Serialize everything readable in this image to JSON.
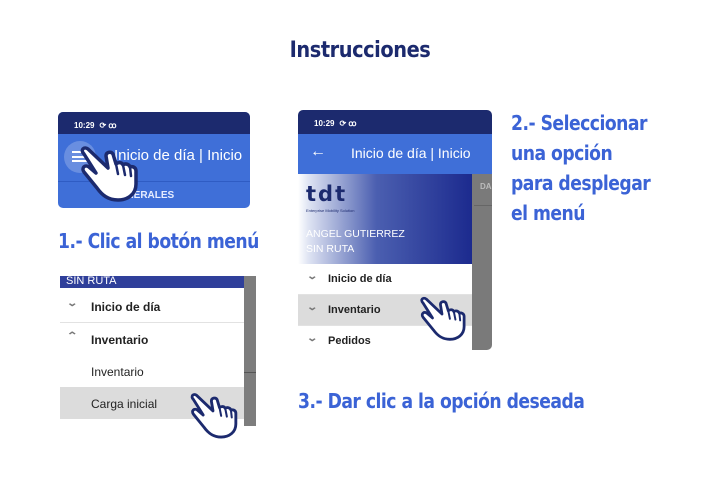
{
  "page": {
    "title": "Instrucciones"
  },
  "colors": {
    "title": "#1c2a6e",
    "step_text": "#3b63d6",
    "app_bar": "#3f6fd8",
    "status_bar": "#1c2a6e",
    "selected_row": "#dcdcdc"
  },
  "steps": [
    {
      "label": "1.- Clic al botón menú"
    },
    {
      "label_lines": [
        "2.- Seleccionar",
        "una opción",
        "para desplegar",
        "el menú"
      ]
    },
    {
      "label": "3.- Dar clic a la opción deseada"
    }
  ],
  "screen1": {
    "status_time": "10:29",
    "status_icons": [
      "sync-off-icon",
      "voicemail-icon"
    ],
    "status_glyphs": "⟳ ꝏ",
    "app_title": "Inicio de día | Inicio",
    "tab_label": "GENERALES",
    "icons": [
      "menu-icon",
      "hand-pointer-icon"
    ]
  },
  "screen2": {
    "status_time": "10:29",
    "status_glyphs": "⟳ ꝏ",
    "back_glyph": "←",
    "app_title": "Inicio de día | Inicio",
    "logo_text": "tdt",
    "logo_tagline": "Enterprise Mobility Solution",
    "user_name": "ANGEL GUTIERREZ",
    "user_route": "SIN RUTA",
    "side_tab": "DA",
    "menu_items": [
      {
        "label": "Inicio de día",
        "chevron": "⌄"
      },
      {
        "label": "Inventario",
        "chevron": "⌄",
        "selected": true
      },
      {
        "label": "Pedidos",
        "chevron": "⌄"
      }
    ]
  },
  "screen3": {
    "top_band": "SIN RUTA",
    "menu_items": [
      {
        "label": "Inicio de día",
        "chevron": "⌄"
      },
      {
        "label": "Inventario",
        "chevron": "⌃",
        "expanded": true
      },
      {
        "label": "Inventario",
        "sub": true
      },
      {
        "label": "Carga inicial",
        "sub": true,
        "selected": true
      }
    ]
  }
}
